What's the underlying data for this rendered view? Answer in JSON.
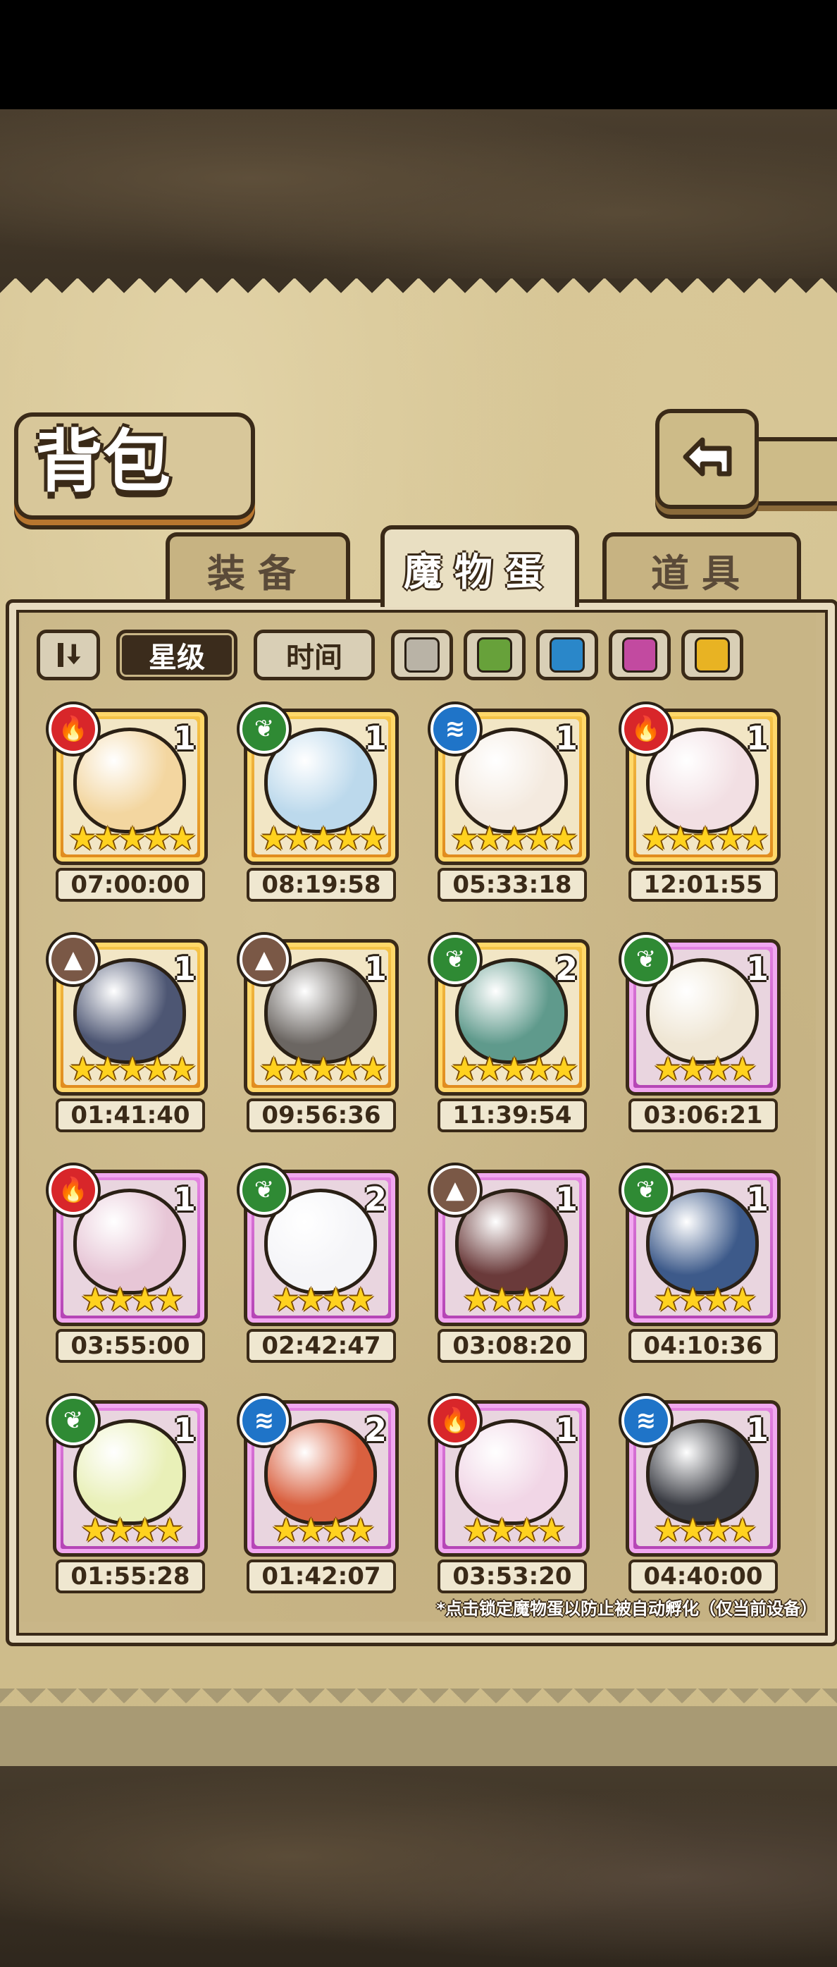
{
  "header": {
    "title": "背包"
  },
  "tabs": [
    {
      "label": "装备",
      "active": false
    },
    {
      "label": "魔物蛋",
      "active": true
    },
    {
      "label": "道具",
      "active": false
    }
  ],
  "filters": {
    "sort_icon": "sort-toggle-icon",
    "star_label": "星级",
    "time_label": "时间",
    "swatches": [
      "#b9b3a6",
      "#67a13a",
      "#2a87c9",
      "#c24aa0",
      "#e8b323"
    ]
  },
  "eggs": [
    {
      "element": "fire",
      "element_icon": "flame-icon",
      "count": "1",
      "stars": "★★★★★",
      "timer": "07:00:00",
      "rarity": "gold",
      "color": "#f3d6a0"
    },
    {
      "element": "leaf",
      "element_icon": "leaf-icon",
      "count": "1",
      "stars": "★★★★★",
      "timer": "08:19:58",
      "rarity": "gold",
      "color": "#bcd9ec"
    },
    {
      "element": "water",
      "element_icon": "water-icon",
      "count": "1",
      "stars": "★★★★★",
      "timer": "05:33:18",
      "rarity": "gold",
      "color": "#f4eadf"
    },
    {
      "element": "fire",
      "element_icon": "flame-icon",
      "count": "1",
      "stars": "★★★★★",
      "timer": "12:01:55",
      "rarity": "gold",
      "color": "#f2dfe3"
    },
    {
      "element": "earth",
      "element_icon": "mountain-icon",
      "count": "1",
      "stars": "★★★★★",
      "timer": "01:41:40",
      "rarity": "gold",
      "color": "#4d5673"
    },
    {
      "element": "earth",
      "element_icon": "mountain-icon",
      "count": "1",
      "stars": "★★★★★",
      "timer": "09:56:36",
      "rarity": "gold",
      "color": "#6b6662"
    },
    {
      "element": "leaf",
      "element_icon": "leaf-icon",
      "count": "2",
      "stars": "★★★★★",
      "timer": "11:39:54",
      "rarity": "gold",
      "color": "#5f9a8c"
    },
    {
      "element": "leaf",
      "element_icon": "leaf-icon",
      "count": "1",
      "stars": "★★★★",
      "timer": "03:06:21",
      "rarity": "purple",
      "color": "#efe6d4"
    },
    {
      "element": "fire",
      "element_icon": "flame-icon",
      "count": "1",
      "stars": "★★★★",
      "timer": "03:55:00",
      "rarity": "purple",
      "color": "#e7c6d6"
    },
    {
      "element": "leaf",
      "element_icon": "leaf-icon",
      "count": "2",
      "stars": "★★★★",
      "timer": "02:42:47",
      "rarity": "purple",
      "color": "#f5f5f8"
    },
    {
      "element": "earth",
      "element_icon": "mountain-icon",
      "count": "1",
      "stars": "★★★★",
      "timer": "03:08:20",
      "rarity": "purple",
      "color": "#6a3a3a"
    },
    {
      "element": "leaf",
      "element_icon": "leaf-icon",
      "count": "1",
      "stars": "★★★★",
      "timer": "04:10:36",
      "rarity": "purple",
      "color": "#3d5a8a"
    },
    {
      "element": "leaf",
      "element_icon": "leaf-icon",
      "count": "1",
      "stars": "★★★★",
      "timer": "01:55:28",
      "rarity": "purple",
      "color": "#e9f0b8"
    },
    {
      "element": "water",
      "element_icon": "water-icon",
      "count": "2",
      "stars": "★★★★",
      "timer": "01:42:07",
      "rarity": "purple",
      "color": "#d9603f"
    },
    {
      "element": "fire",
      "element_icon": "flame-icon",
      "count": "1",
      "stars": "★★★★",
      "timer": "03:53:20",
      "rarity": "purple",
      "color": "#f1d6e6"
    },
    {
      "element": "water",
      "element_icon": "water-icon",
      "count": "1",
      "stars": "★★★★",
      "timer": "04:40:00",
      "rarity": "purple",
      "color": "#3b3d44"
    }
  ],
  "note": "*点击锁定魔物蛋以防止被自动孵化（仅当前设备）"
}
